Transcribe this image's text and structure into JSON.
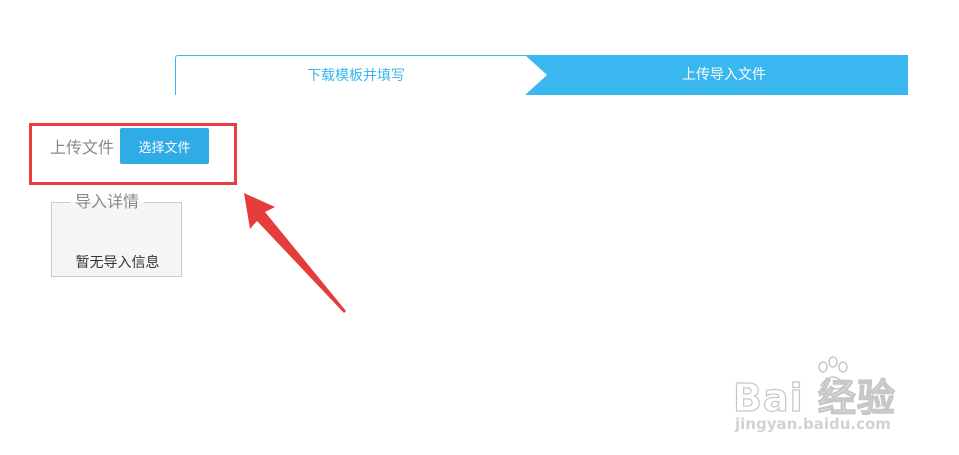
{
  "steps": [
    {
      "label": "下载模板并填写",
      "active": false
    },
    {
      "label": "上传导入文件",
      "active": true
    }
  ],
  "upload": {
    "label": "上传文件",
    "button_label": "选择文件"
  },
  "import_details": {
    "legend": "导入详情",
    "empty_message": "暂无导入信息"
  },
  "watermark": {
    "brand": "Bai  经验",
    "url": "jingyan.baidu.com"
  },
  "colors": {
    "accent": "#39b7ee",
    "button": "#2fabe5",
    "annotation_red": "#e53c3c"
  }
}
